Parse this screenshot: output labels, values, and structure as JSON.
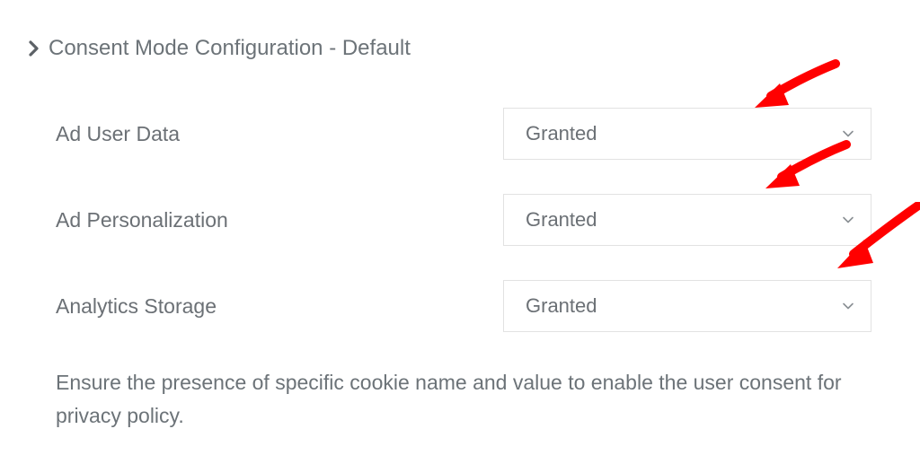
{
  "section": {
    "title": "Consent Mode Configuration - Default"
  },
  "fields": [
    {
      "label": "Ad User Data",
      "value": "Granted"
    },
    {
      "label": "Ad Personalization",
      "value": "Granted"
    },
    {
      "label": "Analytics Storage",
      "value": "Granted"
    }
  ],
  "description": "Ensure the presence of specific cookie name and value to enable the user consent for privacy policy.",
  "colors": {
    "arrow": "#ff0000",
    "text": "#6c7378",
    "border": "#e2e2e2"
  }
}
